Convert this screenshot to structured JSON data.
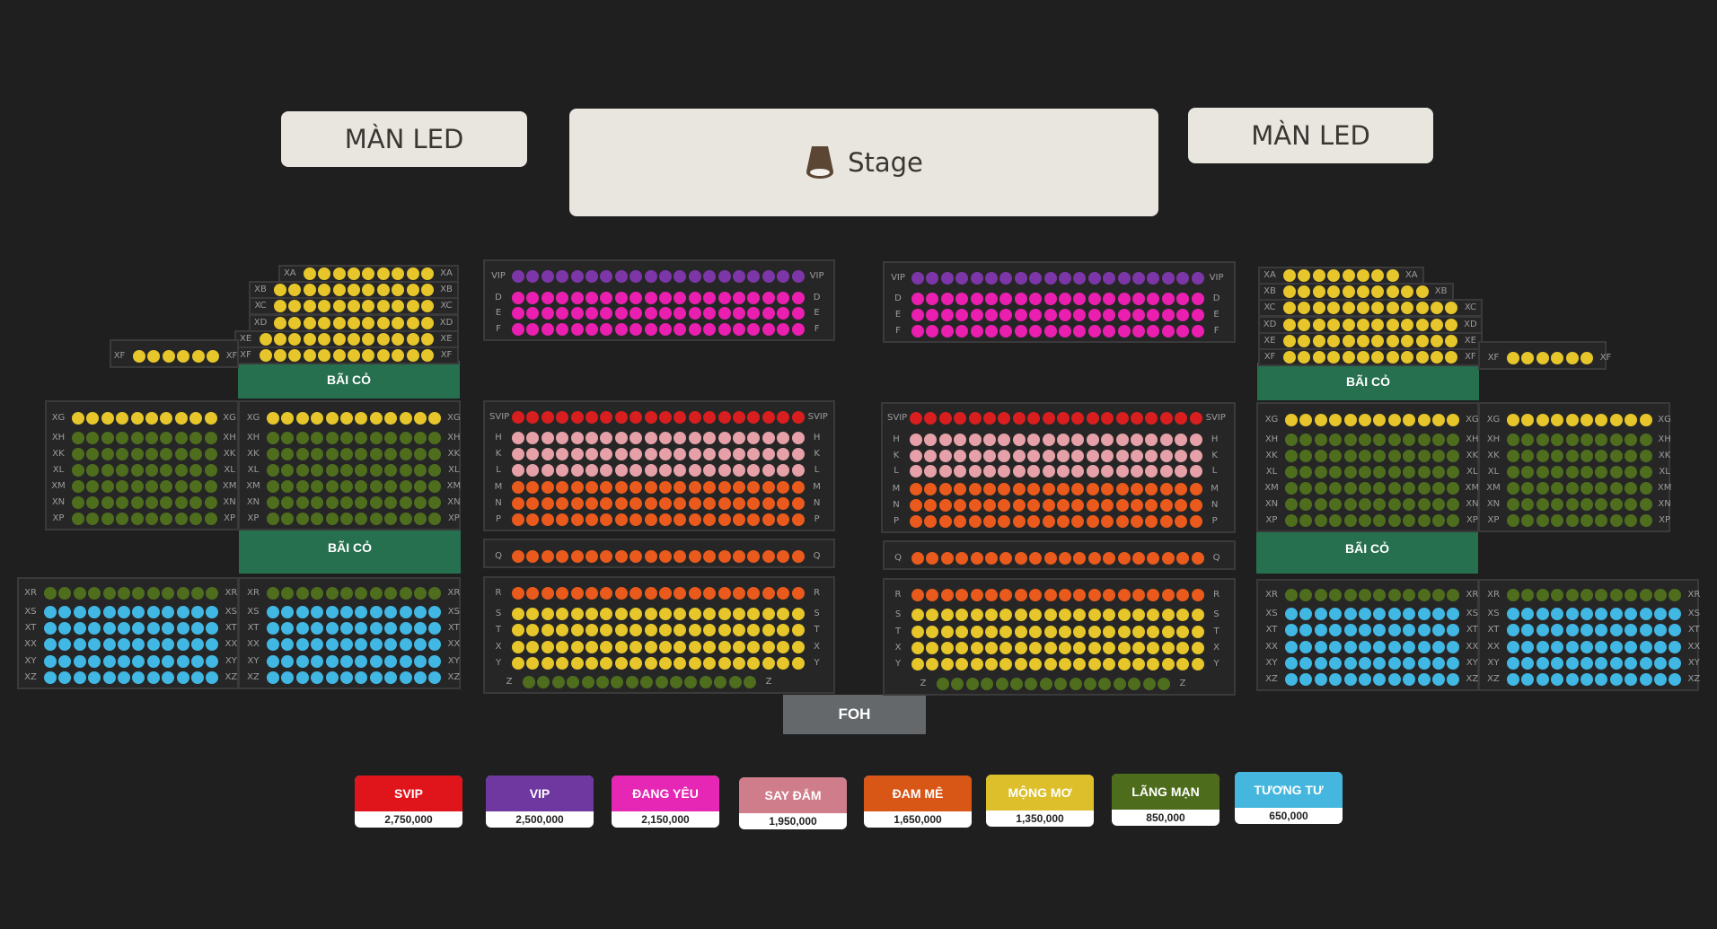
{
  "screens": {
    "left": "MÀN LED",
    "right": "MÀN LED"
  },
  "stage": {
    "label": "Stage",
    "icon": "spotlight-icon"
  },
  "grass_label": "BÃI CỎ",
  "foh_label": "FOH",
  "colors": {
    "svip": "#d81e1e",
    "vip": "#7c36a8",
    "dangyeu": "#ea1fb0",
    "saydam": "#e6a0a8",
    "damme": "#ea5a1c",
    "mongmo": "#e6c62a",
    "langman": "#4e6e1e",
    "tuongtu": "#41b7e3"
  },
  "tiers": [
    {
      "key": "svip",
      "name": "SVIP",
      "price": "2,750,000",
      "color": "#e0151b"
    },
    {
      "key": "vip",
      "name": "VIP",
      "price": "2,500,000",
      "color": "#6f37a0"
    },
    {
      "key": "dangyeu",
      "name": "ĐANG YÊU",
      "price": "2,150,000",
      "color": "#e626b4"
    },
    {
      "key": "saydam",
      "name": "SAY ĐẮM",
      "price": "1,950,000",
      "color": "#cf7d8a"
    },
    {
      "key": "damme",
      "name": "ĐAM MÊ",
      "price": "1,650,000",
      "color": "#d95716"
    },
    {
      "key": "mongmo",
      "name": "MỘNG MƠ",
      "price": "1,350,000",
      "color": "#dcbf2a"
    },
    {
      "key": "langman",
      "name": "LÃNG MẠN",
      "price": "850,000",
      "color": "#4d6d1c"
    },
    {
      "key": "tuongtu",
      "name": "TƯƠNG TƯ",
      "price": "650,000",
      "color": "#45b6de"
    }
  ],
  "sections": [
    {
      "id": "center-left-top",
      "rows": [
        {
          "label": "VIP",
          "tier": "vip",
          "seats": 20
        },
        {
          "label": "D",
          "tier": "dangyeu",
          "seats": 20
        },
        {
          "label": "E",
          "tier": "dangyeu",
          "seats": 20
        },
        {
          "label": "F",
          "tier": "dangyeu",
          "seats": 20
        }
      ]
    },
    {
      "id": "center-right-top",
      "rows": [
        {
          "label": "VIP",
          "tier": "vip",
          "seats": 20
        },
        {
          "label": "D",
          "tier": "dangyeu",
          "seats": 20
        },
        {
          "label": "E",
          "tier": "dangyeu",
          "seats": 20
        },
        {
          "label": "F",
          "tier": "dangyeu",
          "seats": 20
        }
      ]
    },
    {
      "id": "center-left-mid",
      "rows": [
        {
          "label": "SVIP",
          "tier": "svip",
          "seats": 20
        },
        {
          "label": "H",
          "tier": "saydam",
          "seats": 20
        },
        {
          "label": "K",
          "tier": "saydam",
          "seats": 20
        },
        {
          "label": "L",
          "tier": "saydam",
          "seats": 20
        },
        {
          "label": "M",
          "tier": "damme",
          "seats": 20
        },
        {
          "label": "N",
          "tier": "damme",
          "seats": 20
        },
        {
          "label": "P",
          "tier": "damme",
          "seats": 20
        }
      ]
    },
    {
      "id": "center-right-mid",
      "rows": [
        {
          "label": "SVIP",
          "tier": "svip",
          "seats": 20
        },
        {
          "label": "H",
          "tier": "saydam",
          "seats": 20
        },
        {
          "label": "K",
          "tier": "saydam",
          "seats": 20
        },
        {
          "label": "L",
          "tier": "saydam",
          "seats": 20
        },
        {
          "label": "M",
          "tier": "damme",
          "seats": 20
        },
        {
          "label": "N",
          "tier": "damme",
          "seats": 20
        },
        {
          "label": "P",
          "tier": "damme",
          "seats": 20
        }
      ]
    },
    {
      "id": "center-left-q",
      "rows": [
        {
          "label": "Q",
          "tier": "damme",
          "seats": 20
        }
      ]
    },
    {
      "id": "center-right-q",
      "rows": [
        {
          "label": "Q",
          "tier": "damme",
          "seats": 20
        }
      ]
    },
    {
      "id": "center-left-bottom",
      "rows": [
        {
          "label": "R",
          "tier": "damme",
          "seats": 20
        },
        {
          "label": "S",
          "tier": "mongmo",
          "seats": 20
        },
        {
          "label": "T",
          "tier": "mongmo",
          "seats": 20
        },
        {
          "label": "X",
          "tier": "mongmo",
          "seats": 20
        },
        {
          "label": "Y",
          "tier": "mongmo",
          "seats": 20
        },
        {
          "label": "Z",
          "tier": "langman",
          "seats": 16
        }
      ]
    },
    {
      "id": "center-right-bottom",
      "rows": [
        {
          "label": "R",
          "tier": "damme",
          "seats": 20
        },
        {
          "label": "S",
          "tier": "mongmo",
          "seats": 20
        },
        {
          "label": "T",
          "tier": "mongmo",
          "seats": 20
        },
        {
          "label": "X",
          "tier": "mongmo",
          "seats": 20
        },
        {
          "label": "Y",
          "tier": "mongmo",
          "seats": 20
        },
        {
          "label": "Z",
          "tier": "langman",
          "seats": 16
        }
      ]
    },
    {
      "id": "left-upper",
      "rows": [
        {
          "label": "XA",
          "tier": "mongmo",
          "seats": 9
        },
        {
          "label": "XB",
          "tier": "mongmo",
          "seats": 11
        },
        {
          "label": "XC",
          "tier": "mongmo",
          "seats": 11
        },
        {
          "label": "XD",
          "tier": "mongmo",
          "seats": 11
        },
        {
          "label": "XE",
          "tier": "mongmo",
          "seats": 12
        },
        {
          "label": "XF",
          "tier": "mongmo",
          "seats": 12
        }
      ]
    },
    {
      "id": "left-xf-wing",
      "rows": [
        {
          "label": "XF",
          "tier": "mongmo",
          "seats": 6
        }
      ]
    },
    {
      "id": "left-mid-outer",
      "rows": [
        {
          "label": "XG",
          "tier": "mongmo",
          "seats": 10
        },
        {
          "label": "XH",
          "tier": "langman",
          "seats": 10
        },
        {
          "label": "XK",
          "tier": "langman",
          "seats": 10
        },
        {
          "label": "XL",
          "tier": "langman",
          "seats": 10
        },
        {
          "label": "XM",
          "tier": "langman",
          "seats": 10
        },
        {
          "label": "XN",
          "tier": "langman",
          "seats": 10
        },
        {
          "label": "XP",
          "tier": "langman",
          "seats": 10
        }
      ]
    },
    {
      "id": "left-mid-inner",
      "rows": [
        {
          "label": "XG",
          "tier": "mongmo",
          "seats": 12
        },
        {
          "label": "XH",
          "tier": "langman",
          "seats": 12
        },
        {
          "label": "XK",
          "tier": "langman",
          "seats": 12
        },
        {
          "label": "XL",
          "tier": "langman",
          "seats": 12
        },
        {
          "label": "XM",
          "tier": "langman",
          "seats": 12
        },
        {
          "label": "XN",
          "tier": "langman",
          "seats": 12
        },
        {
          "label": "XP",
          "tier": "langman",
          "seats": 12
        }
      ]
    },
    {
      "id": "left-low-outer",
      "rows": [
        {
          "label": "XR",
          "tier": "langman",
          "seats": 12
        },
        {
          "label": "XS",
          "tier": "tuongtu",
          "seats": 12
        },
        {
          "label": "XT",
          "tier": "tuongtu",
          "seats": 12
        },
        {
          "label": "XX",
          "tier": "tuongtu",
          "seats": 12
        },
        {
          "label": "XY",
          "tier": "tuongtu",
          "seats": 12
        },
        {
          "label": "XZ",
          "tier": "tuongtu",
          "seats": 12
        }
      ]
    },
    {
      "id": "left-low-inner",
      "rows": [
        {
          "label": "XR",
          "tier": "langman",
          "seats": 12
        },
        {
          "label": "XS",
          "tier": "tuongtu",
          "seats": 12
        },
        {
          "label": "XT",
          "tier": "tuongtu",
          "seats": 12
        },
        {
          "label": "XX",
          "tier": "tuongtu",
          "seats": 12
        },
        {
          "label": "XY",
          "tier": "tuongtu",
          "seats": 12
        },
        {
          "label": "XZ",
          "tier": "tuongtu",
          "seats": 12
        }
      ]
    },
    {
      "id": "right-upper",
      "rows": [
        {
          "label": "XA",
          "tier": "mongmo",
          "seats": 8
        },
        {
          "label": "XB",
          "tier": "mongmo",
          "seats": 10
        },
        {
          "label": "XC",
          "tier": "mongmo",
          "seats": 12
        },
        {
          "label": "XD",
          "tier": "mongmo",
          "seats": 12
        },
        {
          "label": "XE",
          "tier": "mongmo",
          "seats": 12
        },
        {
          "label": "XF",
          "tier": "mongmo",
          "seats": 12
        }
      ]
    },
    {
      "id": "right-xf-wing",
      "rows": [
        {
          "label": "XF",
          "tier": "mongmo",
          "seats": 6
        }
      ]
    },
    {
      "id": "right-mid-inner",
      "rows": [
        {
          "label": "XG",
          "tier": "mongmo",
          "seats": 12
        },
        {
          "label": "XH",
          "tier": "langman",
          "seats": 12
        },
        {
          "label": "XK",
          "tier": "langman",
          "seats": 12
        },
        {
          "label": "XL",
          "tier": "langman",
          "seats": 12
        },
        {
          "label": "XM",
          "tier": "langman",
          "seats": 12
        },
        {
          "label": "XN",
          "tier": "langman",
          "seats": 12
        },
        {
          "label": "XP",
          "tier": "langman",
          "seats": 12
        }
      ]
    },
    {
      "id": "right-mid-outer",
      "rows": [
        {
          "label": "XG",
          "tier": "mongmo",
          "seats": 10
        },
        {
          "label": "XH",
          "tier": "langman",
          "seats": 10
        },
        {
          "label": "XK",
          "tier": "langman",
          "seats": 10
        },
        {
          "label": "XL",
          "tier": "langman",
          "seats": 10
        },
        {
          "label": "XM",
          "tier": "langman",
          "seats": 10
        },
        {
          "label": "XN",
          "tier": "langman",
          "seats": 10
        },
        {
          "label": "XP",
          "tier": "langman",
          "seats": 10
        }
      ]
    },
    {
      "id": "right-low-inner",
      "rows": [
        {
          "label": "XR",
          "tier": "langman",
          "seats": 12
        },
        {
          "label": "XS",
          "tier": "tuongtu",
          "seats": 12
        },
        {
          "label": "XT",
          "tier": "tuongtu",
          "seats": 12
        },
        {
          "label": "XX",
          "tier": "tuongtu",
          "seats": 12
        },
        {
          "label": "XY",
          "tier": "tuongtu",
          "seats": 12
        },
        {
          "label": "XZ",
          "tier": "tuongtu",
          "seats": 12
        }
      ]
    },
    {
      "id": "right-low-outer",
      "rows": [
        {
          "label": "XR",
          "tier": "langman",
          "seats": 12
        },
        {
          "label": "XS",
          "tier": "tuongtu",
          "seats": 12
        },
        {
          "label": "XT",
          "tier": "tuongtu",
          "seats": 12
        },
        {
          "label": "XX",
          "tier": "tuongtu",
          "seats": 12
        },
        {
          "label": "XY",
          "tier": "tuongtu",
          "seats": 12
        },
        {
          "label": "XZ",
          "tier": "tuongtu",
          "seats": 12
        }
      ]
    }
  ]
}
